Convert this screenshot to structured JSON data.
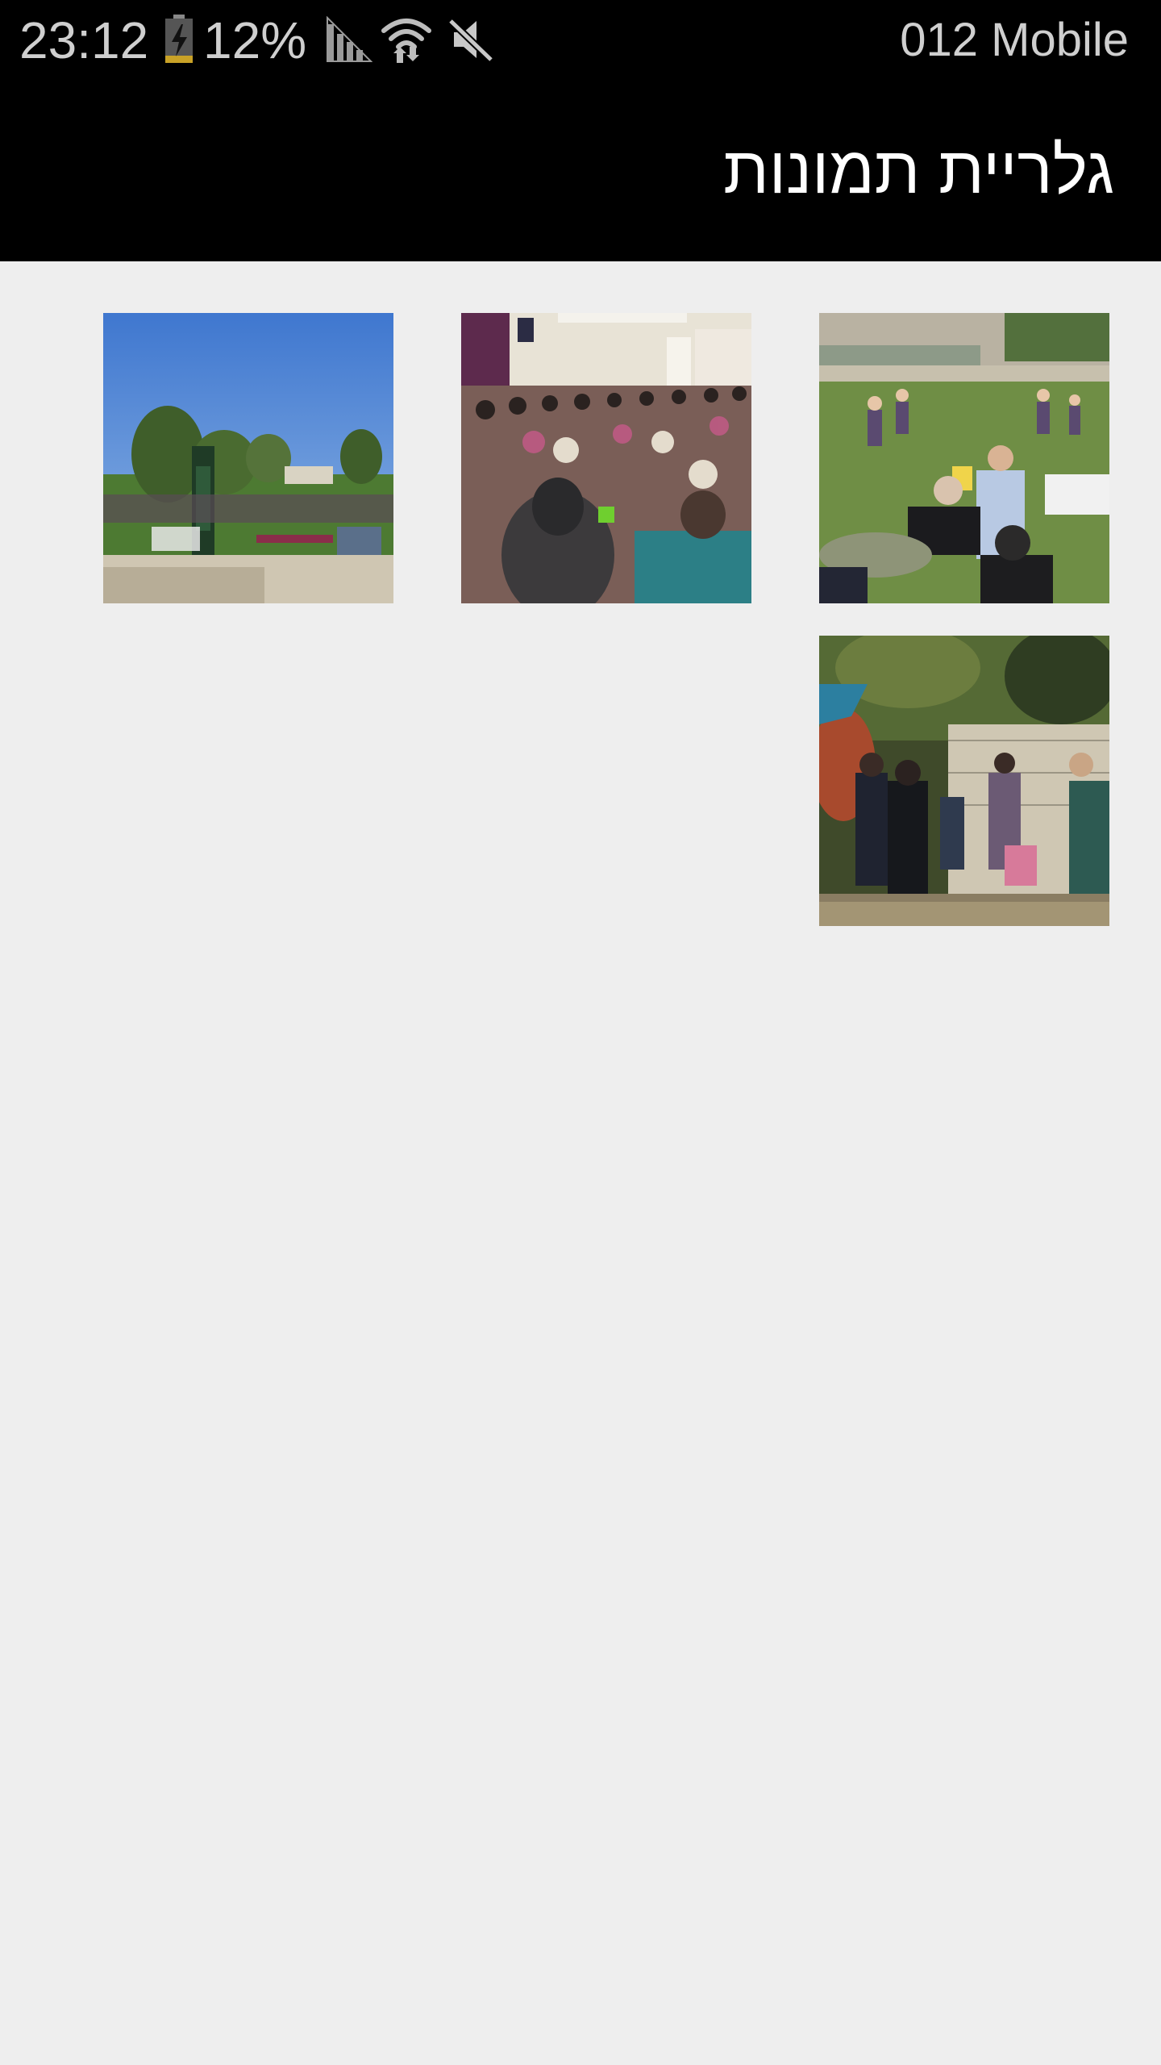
{
  "status_bar": {
    "time": "23:12",
    "battery_percent": "12%",
    "carrier": "012 Mobile",
    "icons": [
      "battery-charging-icon",
      "signal-icon",
      "wifi-icon",
      "mute-icon"
    ]
  },
  "app_bar": {
    "title": "גלריית תמונות"
  },
  "gallery": {
    "photos": [
      {
        "name": "outdoor-park-event-photo"
      },
      {
        "name": "indoor-audience-photo"
      },
      {
        "name": "lawn-gathering-photo"
      },
      {
        "name": "yard-families-photo"
      }
    ]
  },
  "colors": {
    "status_bar_bg": "#000000",
    "app_bar_bg": "#000000",
    "page_bg": "#eeeeee",
    "title_text": "#ffffff",
    "status_text": "#cfcfcf"
  }
}
